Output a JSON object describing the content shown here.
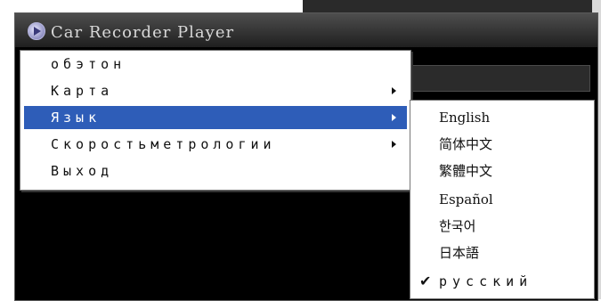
{
  "window": {
    "title": "Car Recorder Player"
  },
  "menu": {
    "items": [
      {
        "label": "обэтон",
        "has_submenu": false
      },
      {
        "label": "Карта",
        "has_submenu": true
      },
      {
        "label": "Язык",
        "has_submenu": true,
        "selected": true
      },
      {
        "label": "Скоростьметрологии",
        "has_submenu": true
      },
      {
        "label": "Выход",
        "has_submenu": false
      }
    ]
  },
  "language_submenu": {
    "items": [
      {
        "label": "English"
      },
      {
        "label": "简体中文"
      },
      {
        "label": "繁體中文"
      },
      {
        "label": "Español"
      },
      {
        "label": "한국어"
      },
      {
        "label": "日本語"
      },
      {
        "label": "русский",
        "checked": true
      }
    ],
    "check_mark": "✔"
  },
  "colors": {
    "selection": "#2e5db8",
    "menu_bg": "#ffffff",
    "window_bg": "#000000"
  },
  "icons": [
    "app-play-icon",
    "submenu-arrow-icon",
    "checkmark-icon"
  ]
}
